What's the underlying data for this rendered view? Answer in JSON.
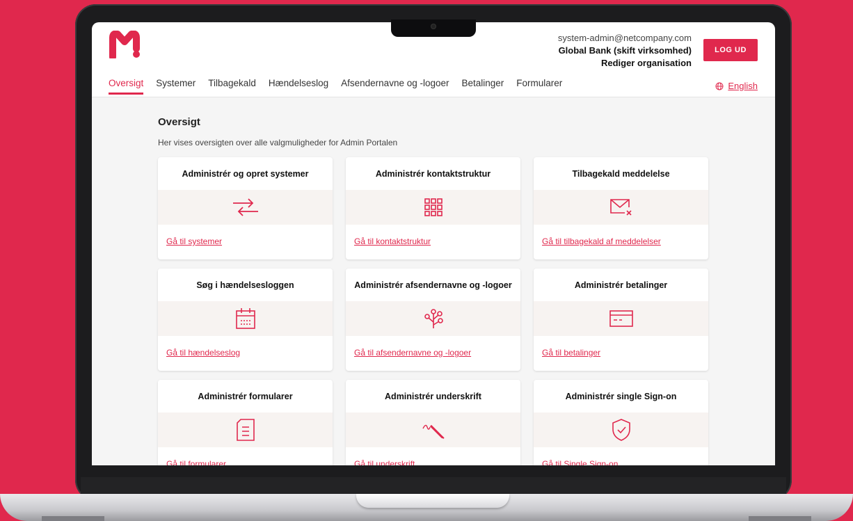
{
  "header": {
    "email": "system-admin@netcompany.com",
    "organization": "Global Bank (skift virksomhed)",
    "edit_org": "Rediger organisation",
    "logout_label": "LOG UD"
  },
  "nav": {
    "tabs": [
      {
        "label": "Oversigt",
        "active": true
      },
      {
        "label": "Systemer"
      },
      {
        "label": "Tilbagekald"
      },
      {
        "label": "Hændelseslog"
      },
      {
        "label": "Afsendernavne og -logoer"
      },
      {
        "label": "Betalinger"
      },
      {
        "label": "Formularer"
      }
    ],
    "language": "English"
  },
  "main": {
    "title": "Oversigt",
    "description": "Her vises oversigten over alle valgmuligheder for Admin Portalen",
    "cards": [
      {
        "title": "Administrér og opret systemer",
        "icon": "arrows-swap-icon",
        "link": "Gå til systemer"
      },
      {
        "title": "Administrér kontaktstruktur",
        "icon": "grid-icon",
        "link": "Gå til kontaktstruktur"
      },
      {
        "title": "Tilbagekald meddelelse",
        "icon": "mail-cancel-icon",
        "link": "Gå til tilbagekald af meddelelser"
      },
      {
        "title": "Søg i hændelsesloggen",
        "icon": "calendar-icon",
        "link": "Gå til hændelseslog"
      },
      {
        "title": "Administrér afsendernavne og -logoer",
        "icon": "tree-icon",
        "link": "Gå til afsendernavne og -logoer"
      },
      {
        "title": "Administrér betalinger",
        "icon": "credit-card-icon",
        "link": "Gå til betalinger"
      },
      {
        "title": "Administrér formularer",
        "icon": "form-icon",
        "link": "Gå til formularer"
      },
      {
        "title": "Administrér underskrift",
        "icon": "pen-icon",
        "link": "Gå til underskrift"
      },
      {
        "title": "Administrér single Sign-on",
        "icon": "shield-check-icon",
        "link": "Gå til Single Sign-on"
      }
    ]
  },
  "colors": {
    "brand": "#e0284d",
    "icon_bg": "#f7f3f1"
  }
}
